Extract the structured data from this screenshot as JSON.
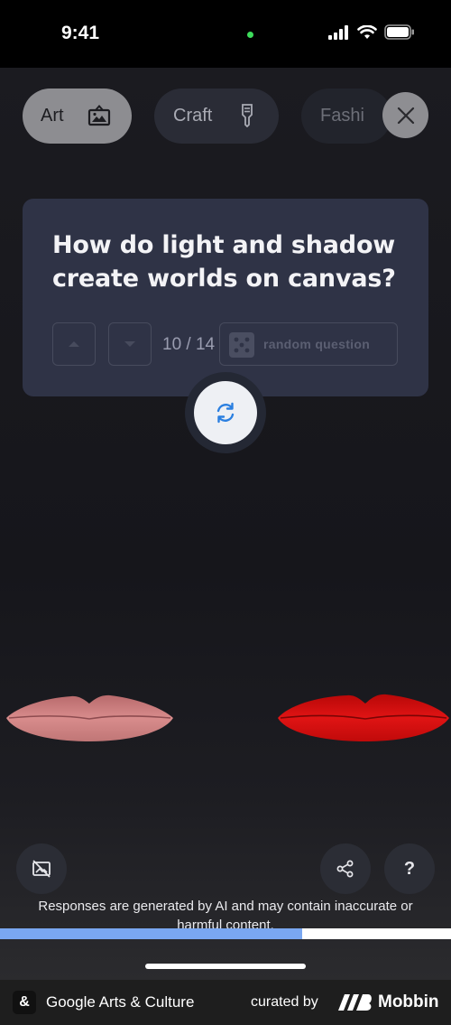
{
  "status_bar": {
    "time": "9:41"
  },
  "categories": [
    {
      "label": "Art",
      "icon": "frame-image-icon",
      "selected": true
    },
    {
      "label": "Craft",
      "icon": "brush-icon",
      "selected": false
    },
    {
      "label": "Fashi",
      "icon": "",
      "selected": false
    }
  ],
  "question_card": {
    "question": "How do light and shadow create worlds on canvas?",
    "counter": "10 / 14",
    "random_label": "random question"
  },
  "disclaimer": "Responses are generated by AI and may contain inaccurate or harmful content.",
  "progress": {
    "value": 0.67,
    "fill_color": "#7aa7f1"
  },
  "footer": {
    "app_name": "Google Arts & Culture",
    "curated_by": "curated by",
    "brand": "Mobbin"
  },
  "colors": {
    "selected_chip": "#8d8d91",
    "card": "#2f3346",
    "lips_left": "#c87878",
    "lips_right": "#d90d0d",
    "accent_blue": "#2b7fe0"
  }
}
